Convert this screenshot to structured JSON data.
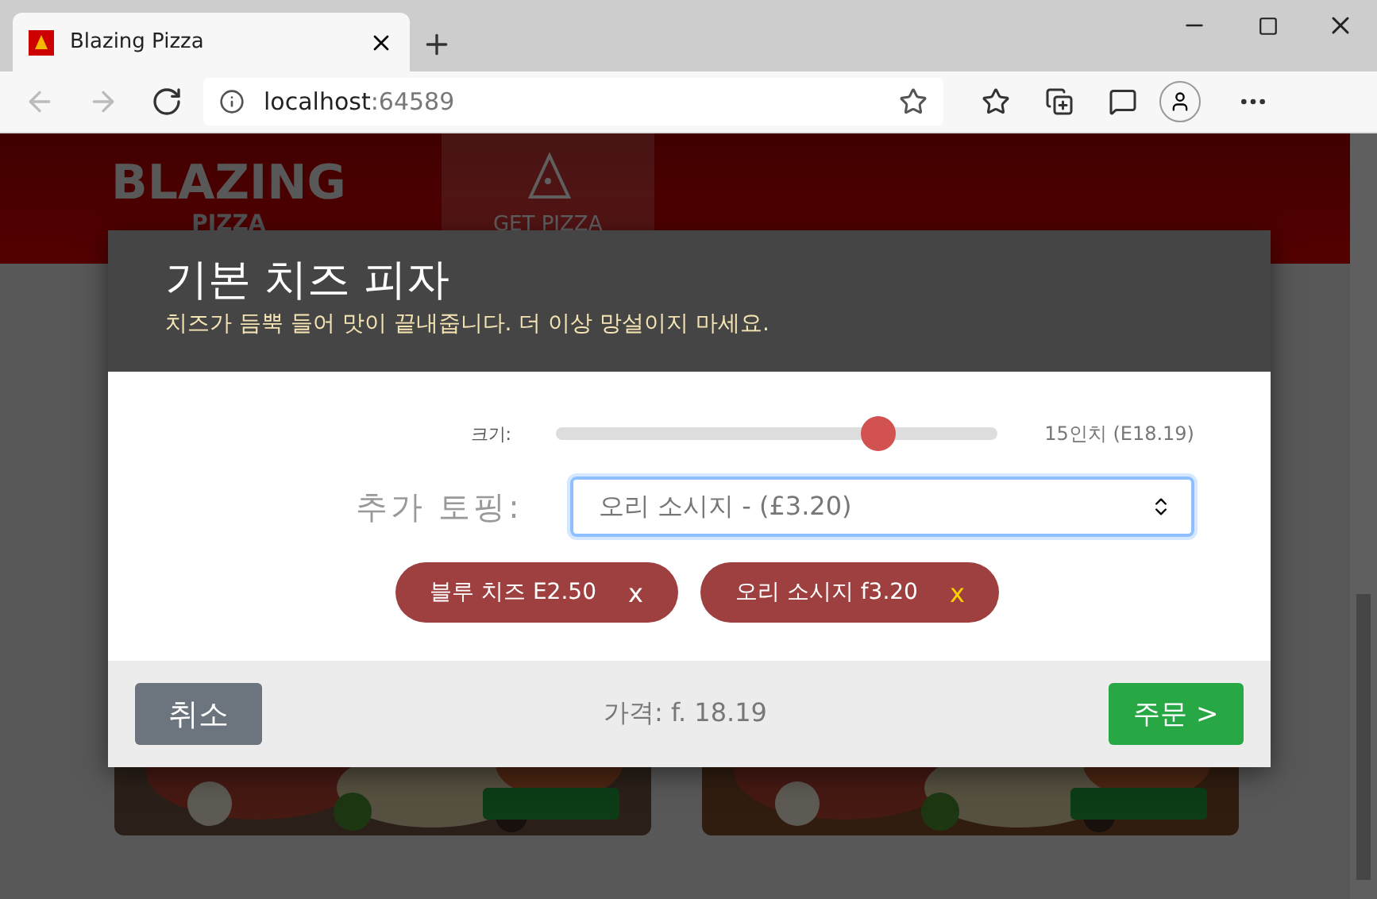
{
  "browser": {
    "tab_title": "Blazing Pizza",
    "url_host": "localhost",
    "url_port": ":64589"
  },
  "site": {
    "logo_top": "BLAZING",
    "logo_bottom": "PIZZA",
    "nav": [
      {
        "label": "GET PIZZA",
        "selected": true
      }
    ]
  },
  "dialog": {
    "title": "기본 치즈 피자",
    "description": "치즈가 듬뿍 들어 맛이 끝내줍니다. 더 이상 망설이지 마세요.",
    "size": {
      "label": "크기:",
      "level": 0.73,
      "reading": "15인치 (E18.19)"
    },
    "toppings": {
      "label": "추가 토핑:",
      "value": "오리 소시지 - (£3.20)"
    },
    "chips": [
      {
        "label": "블루 치즈 E2.50",
        "remove": "x",
        "highlighted": false
      },
      {
        "label": "오리 소시지 f3.20",
        "remove": "x",
        "highlighted": true
      }
    ],
    "cancel": "취소",
    "price": "가격: f. 18.19",
    "order": "주문 >"
  }
}
